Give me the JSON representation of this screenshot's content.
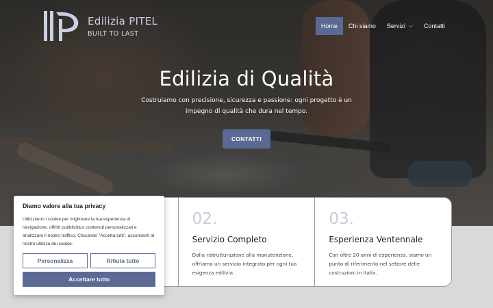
{
  "header": {
    "brand_name": "Edilizia PITEL",
    "brand_tagline": "BUILT TO LAST",
    "nav": [
      {
        "label": "Home",
        "active": true
      },
      {
        "label": "Chi siamo",
        "active": false
      },
      {
        "label": "Servizi",
        "active": false,
        "has_dropdown": true,
        "icon": "chevron-down-icon"
      },
      {
        "label": "Contatti",
        "active": false
      }
    ]
  },
  "hero": {
    "title": "Edilizia di Qualità",
    "subtitle": "Costruiamo con precisione, sicurezza e passione: ogni progetto è un impegno di qualità che dura nel tempo.",
    "cta_label": "CONTATTI"
  },
  "cards": [
    {
      "number": "",
      "title": "",
      "text": ""
    },
    {
      "number": "02.",
      "title": "Servizio Completo",
      "text": "Dalla ristrutturazione alla manutenzione, offriamo un servizio integrato per ogni tua esigenza edilizia."
    },
    {
      "number": "03.",
      "title": "Esperienza Ventennale",
      "text": "Con oltre 20 anni di esperienza, siamo un punto di riferimento nel settore delle costruzioni in Italia."
    }
  ],
  "cookie_banner": {
    "title": "Diamo valore alla tua privacy",
    "text": "Utilizziamo i cookie per migliorare la tua esperienza di navigazione, offrirti pubblicità o contenuti personalizzati e analizzare il nostro traffico. Cliccando \"Accetta tutti\", acconsenti al nostro utilizzo dei cookie.",
    "customize_label": "Personalizza",
    "reject_label": "Rifiuta tutto",
    "accept_label": "Accettare tutto"
  },
  "colors": {
    "accent": "#5b6a94",
    "card_number": "#c5cadb"
  }
}
